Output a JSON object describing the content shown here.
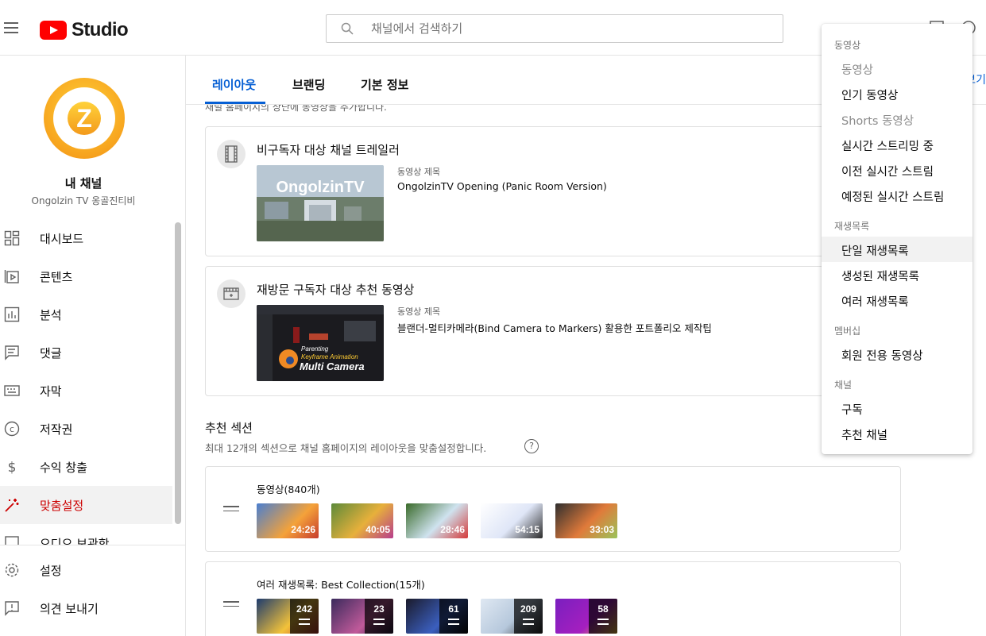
{
  "app": {
    "logo_text": "Studio",
    "brand_color": "#ff0000",
    "accent": "#065fd4"
  },
  "search": {
    "placeholder": "채널에서 검색하기"
  },
  "sidebar": {
    "channel_title": "내 채널",
    "channel_name": "Ongolzin TV 옹골진티비",
    "avatar_letter": "Z",
    "items": [
      {
        "label": "대시보드",
        "icon": "dashboard-icon"
      },
      {
        "label": "콘텐츠",
        "icon": "content-icon"
      },
      {
        "label": "분석",
        "icon": "analytics-icon"
      },
      {
        "label": "댓글",
        "icon": "comments-icon"
      },
      {
        "label": "자막",
        "icon": "subtitles-icon"
      },
      {
        "label": "저작권",
        "icon": "copyright-icon"
      },
      {
        "label": "수익 창출",
        "icon": "monetization-icon"
      },
      {
        "label": "맞춤설정",
        "icon": "customization-icon",
        "active": true
      },
      {
        "label": "오디오 보관함",
        "icon": "audio-library-icon"
      }
    ],
    "bottom": [
      {
        "label": "설정",
        "icon": "settings-icon"
      },
      {
        "label": "의견 보내기",
        "icon": "feedback-icon"
      }
    ]
  },
  "tabs": [
    {
      "label": "레이아웃",
      "active": true
    },
    {
      "label": "브랜딩"
    },
    {
      "label": "기본 정보"
    }
  ],
  "tab_right_link": "보기",
  "cut_text": "채널 홈페이지의 상단에 동영상을 추가합니다.",
  "trailer_card": {
    "title": "비구독자 대상 채널 트레일러",
    "video_label": "동영상 제목",
    "video_title": "OngolzinTV Opening (Panic Room Version)",
    "thumb_text": "OngolzinTV"
  },
  "featured_card": {
    "title": "재방문 구독자 대상 추천 동영상",
    "video_label": "동영상 제목",
    "video_title": "블랜더-멀티카메라(Bind Camera to Markers) 활용한 포트폴리오 제작팁",
    "thumb_line1": "Parenting",
    "thumb_line2": "Keyframe Animation",
    "thumb_line3": "Multi Camera"
  },
  "sections": {
    "title": "추천 섹션",
    "description": "최대 12개의 섹션으로 채널 홈페이지의 레이아웃을 맞춤설정합니다.",
    "help": "?",
    "rows": [
      {
        "title": "동영상(840개)",
        "durations": [
          "24:26",
          "40:05",
          "28:46",
          "54:15",
          "33:03"
        ]
      },
      {
        "title": "여러 재생목록: Best Collection(15개)",
        "counts": [
          "242",
          "23",
          "61",
          "209",
          "58"
        ]
      }
    ]
  },
  "dropdown": {
    "groups": [
      {
        "header": "동영상",
        "items": [
          {
            "label": "동영상",
            "disabled": true
          },
          {
            "label": "인기 동영상"
          },
          {
            "label": "Shorts 동영상",
            "disabled": true
          },
          {
            "label": "실시간 스트리밍 중"
          },
          {
            "label": "이전 실시간 스트림"
          },
          {
            "label": "예정된 실시간 스트림"
          }
        ]
      },
      {
        "header": "재생목록",
        "items": [
          {
            "label": "단일 재생목록",
            "hover": true
          },
          {
            "label": "생성된 재생목록"
          },
          {
            "label": "여러 재생목록"
          }
        ]
      },
      {
        "header": "멤버십",
        "items": [
          {
            "label": "회원 전용 동영상"
          }
        ]
      },
      {
        "header": "채널",
        "items": [
          {
            "label": "구독"
          },
          {
            "label": "추천 채널"
          }
        ]
      }
    ]
  }
}
